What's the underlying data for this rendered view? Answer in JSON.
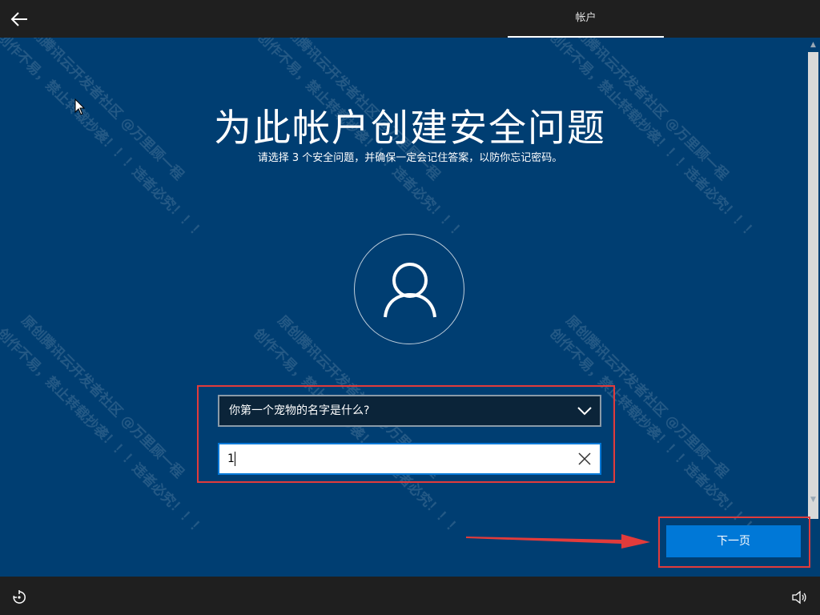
{
  "header": {
    "back_icon": "back-arrow-icon",
    "tab_label": "帐户"
  },
  "main": {
    "title": "为此帐户创建安全问题",
    "subtitle": "请选择 3 个安全问题，并确保一定会记住答案，以防你忘记密码。",
    "avatar_icon": "user-icon"
  },
  "form": {
    "question_selected": "你第一个宠物的名字是什么?",
    "answer_value": "1",
    "clear_icon": "close-icon",
    "dropdown_icon": "chevron-down-icon"
  },
  "footer": {
    "next_label": "下一页",
    "ease_icon": "ease-of-access-icon",
    "volume_icon": "volume-icon"
  },
  "watermark": {
    "line1": "创作不易，禁止转载抄袭！！！违者必究！！！",
    "line2": "原创腾讯云开发者社区 @万里顾一程"
  },
  "colors": {
    "background": "#003e72",
    "bar": "#1f1f1f",
    "accent": "#0078d7",
    "annotation": "#e23b3b"
  }
}
